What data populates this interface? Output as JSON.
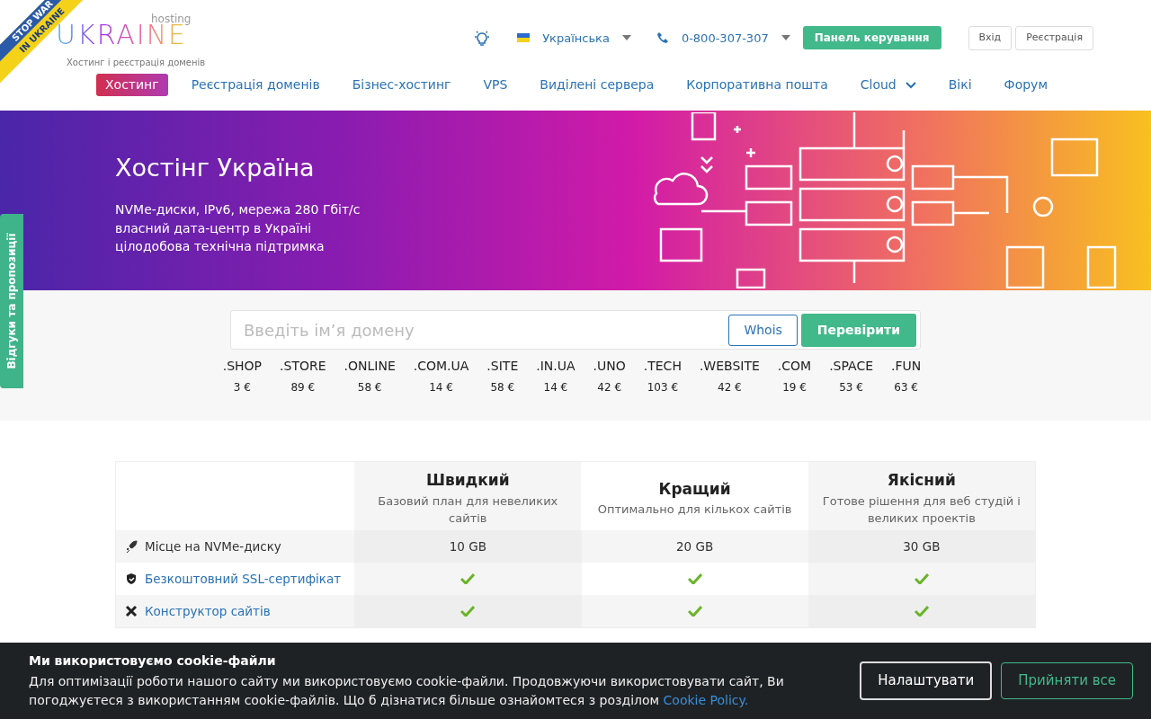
{
  "ribbon": {
    "line1": "STOP WAR",
    "line2": "IN UKRAINE"
  },
  "logo": {
    "wordmark": "UKRAINE",
    "super": "hosting",
    "tagline": "Хостинг і реєстрація доменів"
  },
  "topbar": {
    "language": "Українська",
    "phone": "0-800-307-307",
    "panel_button": "Панель керування",
    "login": "Вхід",
    "register": "Реєстрація"
  },
  "nav": [
    {
      "label": "Хостинг",
      "selected": true,
      "dropdown": false
    },
    {
      "label": "Реєстрація доменів",
      "selected": false,
      "dropdown": false
    },
    {
      "label": "Бізнес-хостинг",
      "selected": false,
      "dropdown": false
    },
    {
      "label": "VPS",
      "selected": false,
      "dropdown": false
    },
    {
      "label": "Виділені сервера",
      "selected": false,
      "dropdown": false
    },
    {
      "label": "Корпоративна пошта",
      "selected": false,
      "dropdown": false
    },
    {
      "label": "Cloud",
      "selected": false,
      "dropdown": true
    },
    {
      "label": "Вікі",
      "selected": false,
      "dropdown": false
    },
    {
      "label": "Форум",
      "selected": false,
      "dropdown": false
    }
  ],
  "hero": {
    "title": "Хостінг Україна",
    "lines": [
      "NVMe-диски, IPv6, мережа 280 Гбіт/с",
      "власний дата-центр в Україні",
      "цілодобова технічна підтримка"
    ]
  },
  "feedback_tab": "Відгуки та пропозиції",
  "domain_search": {
    "placeholder": "Введіть ім’я домену",
    "whois": "Whois",
    "check": "Перевірити"
  },
  "zones": [
    {
      "name": ".SHOP",
      "price": "3 €"
    },
    {
      "name": ".STORE",
      "price": "89 €"
    },
    {
      "name": ".ONLINE",
      "price": "58 €"
    },
    {
      "name": ".COM.UA",
      "price": "14 €"
    },
    {
      "name": ".SITE",
      "price": "58 €"
    },
    {
      "name": ".IN.UA",
      "price": "14 €"
    },
    {
      "name": ".UNO",
      "price": "42 €"
    },
    {
      "name": ".TECH",
      "price": "103 €"
    },
    {
      "name": ".WEBSITE",
      "price": "42 €"
    },
    {
      "name": ".COM",
      "price": "19 €"
    },
    {
      "name": ".SPACE",
      "price": "53 €"
    },
    {
      "name": ".FUN",
      "price": "63 €"
    }
  ],
  "plans": {
    "columns": [
      {
        "name": "Швидкий",
        "desc": "Базовий план для невеликих сайтів"
      },
      {
        "name": "Кращий",
        "desc": "Оптимально для кількох сайтів"
      },
      {
        "name": "Якісний",
        "desc": "Готове рішення для веб студій і великих проектів"
      }
    ],
    "rows": [
      {
        "label": "Місце на NVMe-диску",
        "link": false,
        "kind": "text",
        "values": [
          "10 GB",
          "20 GB",
          "30 GB"
        ]
      },
      {
        "label": "Безкоштовний SSL-сертифікат",
        "link": true,
        "kind": "check"
      },
      {
        "label": "Конструктор сайтів",
        "link": true,
        "kind": "check"
      }
    ]
  },
  "cookie": {
    "title": "Ми використовуємо cookie-файли",
    "text": "Для оптимізації роботи нашого сайту ми використовуємо cookie-файли. Продовжуючи використовувати сайт, Ви погоджуєтеся з використанням cookie-файлів. Що б дізнатися більше ознайомтеся з розділом",
    "link": "Cookie Policy.",
    "settings": "Налаштувати",
    "accept": "Прийняти все"
  }
}
